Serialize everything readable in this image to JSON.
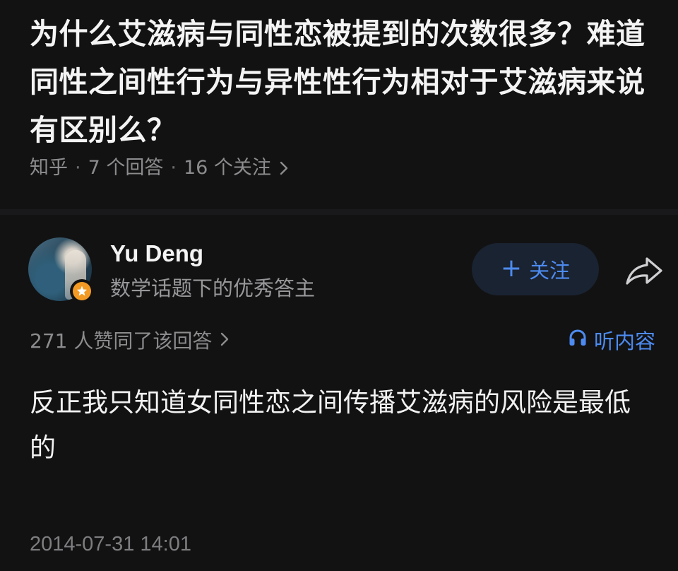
{
  "question": {
    "title": "为什么艾滋病与同性恋被提到的次数很多？难道同性之间性行为与异性性行为相对于艾滋病来说有区别么？",
    "source": "知乎",
    "separator": "·",
    "answers_count": "7 个回答",
    "followers_count": "16 个关注",
    "chevron_icon": "chevron-right-icon"
  },
  "author": {
    "name": "Yu Deng",
    "description": "数学话题下的优秀答主",
    "avatar_icon": "avatar",
    "badge_icon": "excellent-answerer-badge-icon",
    "badge_color": "#f29a24"
  },
  "actions": {
    "follow_plus": "+",
    "follow_label": "关注",
    "follow_color": "#4d8bf0",
    "share_icon": "share-arrow-icon"
  },
  "answer": {
    "votes_label": "271 人赞同了该回答",
    "listen_label": "听内容",
    "listen_icon": "headphones-icon",
    "content": "反正我只知道女同性恋之间传播艾滋病的风险是最低的",
    "timestamp": "2014-07-31 14:01"
  },
  "colors": {
    "background": "#121213",
    "accent": "#4d8bf0",
    "primary_text": "#f2f2f2",
    "secondary_text": "#8c8c8e"
  }
}
